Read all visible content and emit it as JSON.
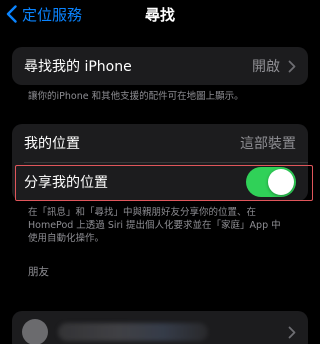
{
  "navbar": {
    "back_label": "定位服務",
    "title": "尋找"
  },
  "find_iphone": {
    "label": "尋找我的 iPhone",
    "value": "開啟",
    "footnote": "讓你的iPhone 和其他支援的配件可在地圖上顯示。"
  },
  "my_location": {
    "label": "我的位置",
    "value": "這部裝置"
  },
  "share_location": {
    "label": "分享我的位置",
    "enabled": true,
    "footnote_lines": [
      "在「訊息」和「尋找」中與親朋好友分享你的位置、在",
      "HomePod 上透過 Siri 提出個人化要求並在「家庭」App 中",
      "使用自動化操作。"
    ]
  },
  "friends": {
    "header": "朋友"
  },
  "colors": {
    "accent": "#0a84ff",
    "toggle_on": "#30d158",
    "cell_bg": "#1c1c1e",
    "secondary_text": "#8e8e93",
    "highlight": "#e0565b"
  }
}
